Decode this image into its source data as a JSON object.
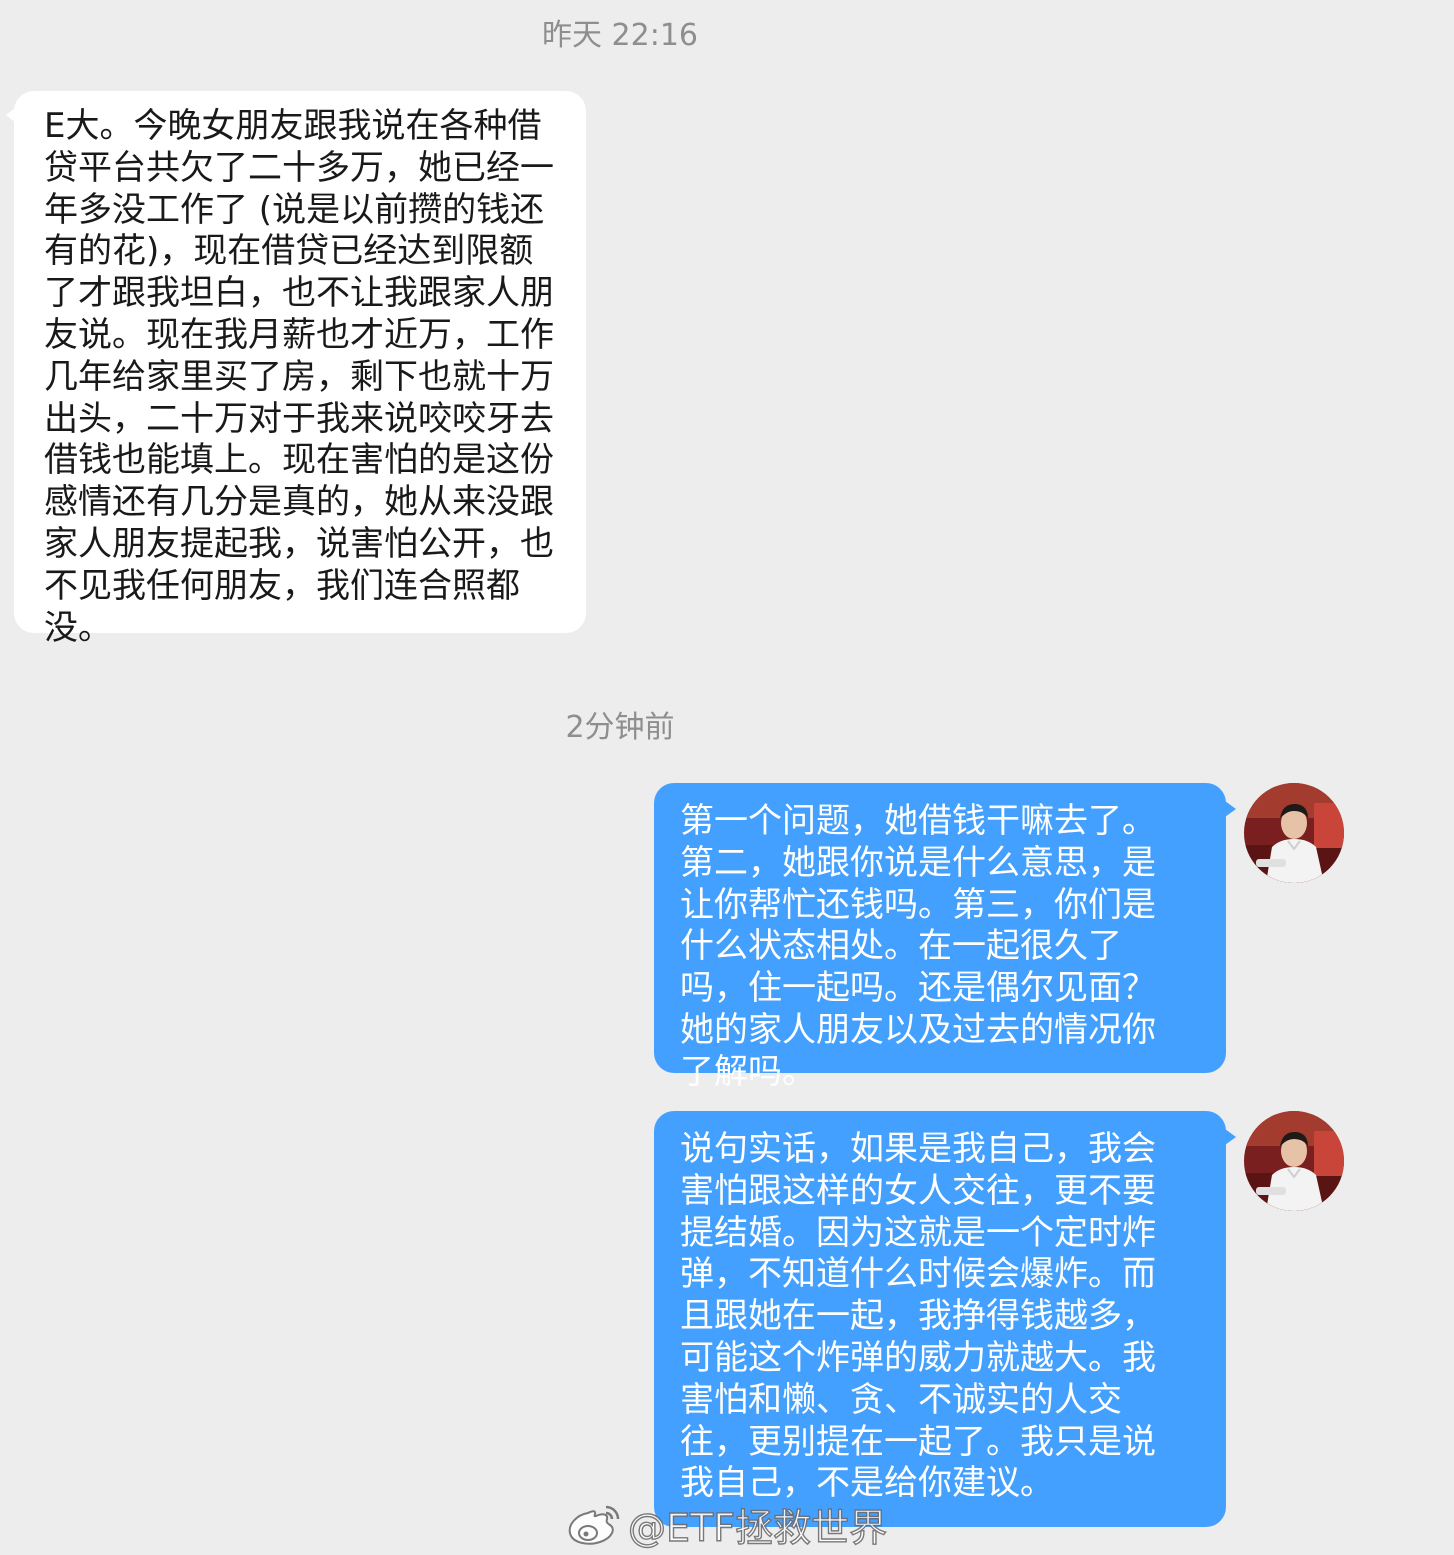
{
  "chat": {
    "timestamps": [
      "昨天 22:16",
      "2分钟前"
    ],
    "messages": [
      {
        "direction": "incoming",
        "text": "E大。今晚女朋友跟我说在各种借贷平台共欠了二十多万，她已经一年多没工作了 (说是以前攒的钱还有的花)，现在借贷已经达到限额了才跟我坦白，也不让我跟家人朋友说。现在我月薪也才近万，工作几年给家里买了房，剩下也就十万出头，二十万对于我来说咬咬牙去借钱也能填上。现在害怕的是这份感情还有几分是真的，她从来没跟家人朋友提起我，说害怕公开，也不见我任何朋友，我们连合照都没。"
      },
      {
        "direction": "outgoing",
        "text": "第一个问题，她借钱干嘛去了。第二，她跟你说是什么意思，是让你帮忙还钱吗。第三，你们是什么状态相处。在一起很久了吗，住一起吗。还是偶尔见面？她的家人朋友以及过去的情况你了解吗。"
      },
      {
        "direction": "outgoing",
        "text": "说句实话，如果是我自己，我会害怕跟这样的女人交往，更不要提结婚。因为这就是一个定时炸弹，不知道什么时候会爆炸。而且跟她在一起，我挣得钱越多，可能这个炸弹的威力就越大。我害怕和懒、贪、不诚实的人交往，更别提在一起了。我只是说我自己，不是给你建议。"
      }
    ]
  },
  "watermark": {
    "text": "@ETF拯救世界",
    "icon": "weibo-icon"
  },
  "colors": {
    "background": "#ededed",
    "incoming_bubble": "#ffffff",
    "outgoing_bubble": "#44a0ff",
    "timestamp": "#8e8e8e"
  }
}
